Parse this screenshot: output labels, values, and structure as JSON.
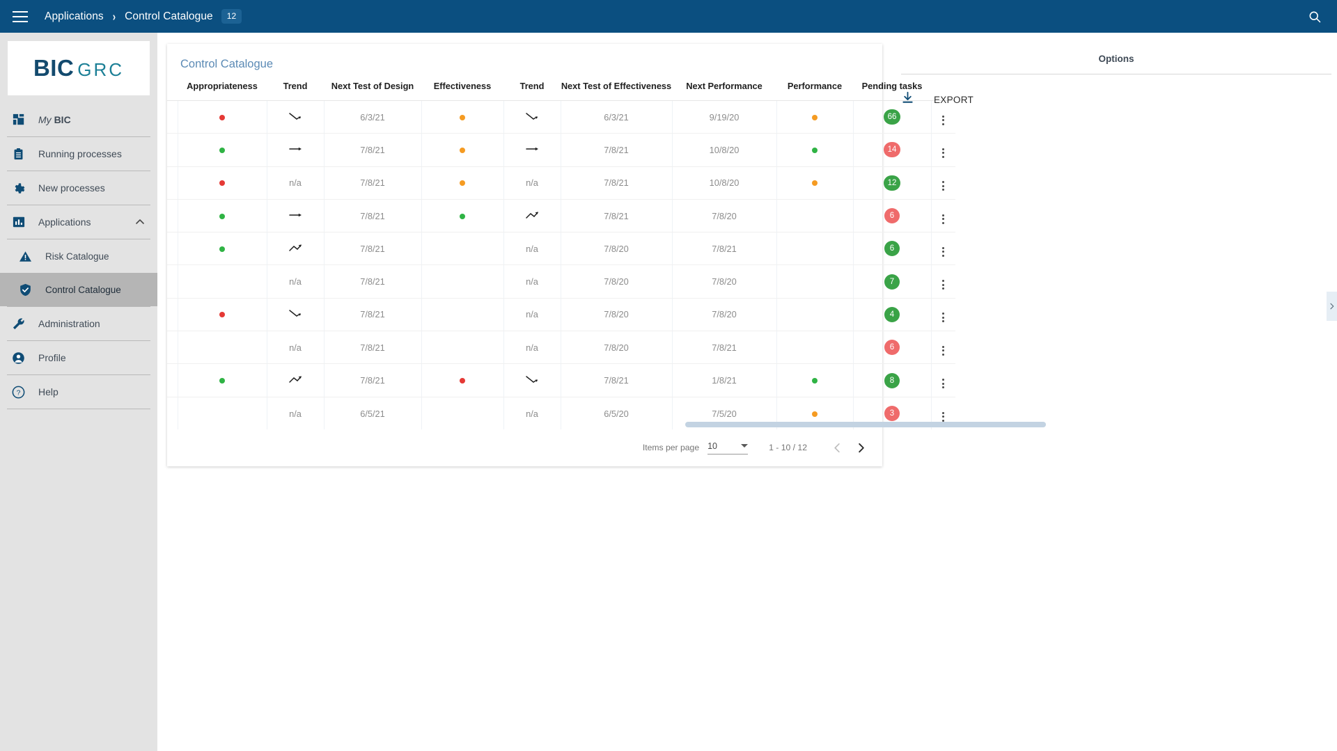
{
  "topbar": {
    "menu_icon": "hamburger-icon",
    "breadcrumb_root": "Applications",
    "breadcrumb_sep": "›",
    "breadcrumb_current": "Control Catalogue",
    "breadcrumb_badge": "12",
    "search_icon": "search-icon",
    "bg_color": "#0b4f80"
  },
  "sidebar": {
    "logo_primary": "BIC",
    "logo_secondary": "GRC",
    "logo_primary_color": "#134a6e",
    "logo_secondary_color": "#1b7f96",
    "items": [
      {
        "label_italic": "My ",
        "label_bold": "BIC",
        "icon": "dashboard-icon",
        "active": false,
        "sub": false
      },
      {
        "label": "Running processes",
        "icon": "clipboard-icon",
        "active": false,
        "sub": false
      },
      {
        "label": "New processes",
        "icon": "gear-icon",
        "active": false,
        "sub": false
      },
      {
        "label": "Applications",
        "icon": "chart-icon",
        "active": false,
        "sub": false,
        "expanded": true
      },
      {
        "label": "Risk Catalogue",
        "icon": "warning-triangle-icon",
        "active": false,
        "sub": true
      },
      {
        "label": "Control Catalogue",
        "icon": "shield-check-icon",
        "active": true,
        "sub": true
      },
      {
        "label": "Administration",
        "icon": "wrench-icon",
        "active": false,
        "sub": false
      },
      {
        "label": "Profile",
        "icon": "user-icon",
        "active": false,
        "sub": false
      },
      {
        "label": "Help",
        "icon": "help-icon",
        "active": false,
        "sub": false
      }
    ]
  },
  "main": {
    "title": "Control Catalogue",
    "columns": [
      "Appropriateness",
      "Trend",
      "Next Test of Design",
      "Effectiveness",
      "Trend",
      "Next Test of Effectiveness",
      "Next Performance",
      "Performance",
      "Pending tasks"
    ],
    "na_text": "n/a",
    "colors": {
      "red": "#e53935",
      "green": "#2fb344",
      "orange": "#f59b22",
      "badge_green": "#3aa347",
      "badge_red": "#ef6b6b"
    },
    "rows": [
      {
        "appropriateness": "red",
        "trend_design": "down",
        "next_test_design": "6/3/21",
        "effectiveness": "orange",
        "trend_effectiveness": "down",
        "next_test_effectiveness": "6/3/21",
        "next_performance": "9/19/20",
        "performance": "orange",
        "pending_tasks": "66",
        "pending_color": "green"
      },
      {
        "appropriateness": "green",
        "trend_design": "flat",
        "next_test_design": "7/8/21",
        "effectiveness": "orange",
        "trend_effectiveness": "flat",
        "next_test_effectiveness": "7/8/21",
        "next_performance": "10/8/20",
        "performance": "green",
        "pending_tasks": "14",
        "pending_color": "red"
      },
      {
        "appropriateness": "red",
        "trend_design": "na",
        "next_test_design": "7/8/21",
        "effectiveness": "orange",
        "trend_effectiveness": "na",
        "next_test_effectiveness": "7/8/21",
        "next_performance": "10/8/20",
        "performance": "orange",
        "pending_tasks": "12",
        "pending_color": "green"
      },
      {
        "appropriateness": "green",
        "trend_design": "flat",
        "next_test_design": "7/8/21",
        "effectiveness": "green",
        "trend_effectiveness": "up",
        "next_test_effectiveness": "7/8/21",
        "next_performance": "7/8/20",
        "performance": "none",
        "pending_tasks": "6",
        "pending_color": "red"
      },
      {
        "appropriateness": "green",
        "trend_design": "up",
        "next_test_design": "7/8/21",
        "effectiveness": "none",
        "trend_effectiveness": "na",
        "next_test_effectiveness": "7/8/20",
        "next_performance": "7/8/21",
        "performance": "none",
        "pending_tasks": "6",
        "pending_color": "green"
      },
      {
        "appropriateness": "none",
        "trend_design": "na",
        "next_test_design": "7/8/21",
        "effectiveness": "none",
        "trend_effectiveness": "na",
        "next_test_effectiveness": "7/8/20",
        "next_performance": "7/8/20",
        "performance": "none",
        "pending_tasks": "7",
        "pending_color": "green"
      },
      {
        "appropriateness": "red",
        "trend_design": "down",
        "next_test_design": "7/8/21",
        "effectiveness": "none",
        "trend_effectiveness": "na",
        "next_test_effectiveness": "7/8/20",
        "next_performance": "7/8/20",
        "performance": "none",
        "pending_tasks": "4",
        "pending_color": "green"
      },
      {
        "appropriateness": "none",
        "trend_design": "na",
        "next_test_design": "7/8/21",
        "effectiveness": "none",
        "trend_effectiveness": "na",
        "next_test_effectiveness": "7/8/20",
        "next_performance": "7/8/21",
        "performance": "none",
        "pending_tasks": "6",
        "pending_color": "red"
      },
      {
        "appropriateness": "green",
        "trend_design": "up",
        "next_test_design": "7/8/21",
        "effectiveness": "red",
        "trend_effectiveness": "down",
        "next_test_effectiveness": "7/8/21",
        "next_performance": "1/8/21",
        "performance": "green",
        "pending_tasks": "8",
        "pending_color": "green"
      },
      {
        "appropriateness": "none",
        "trend_design": "na",
        "next_test_design": "6/5/21",
        "effectiveness": "none",
        "trend_effectiveness": "na",
        "next_test_effectiveness": "6/5/20",
        "next_performance": "7/5/20",
        "performance": "orange",
        "pending_tasks": "3",
        "pending_color": "red"
      }
    ],
    "paginator": {
      "items_per_page_label": "Items per page",
      "items_per_page_value": "10",
      "range_label": "1 - 10 / 12",
      "prev_icon": "chevron-left-icon",
      "next_icon": "chevron-right-icon"
    }
  },
  "options_panel": {
    "title": "Options",
    "export_label": "EXPORT",
    "export_icon": "download-icon"
  },
  "drawer": {
    "handle_icon": "chevron-right-icon"
  }
}
